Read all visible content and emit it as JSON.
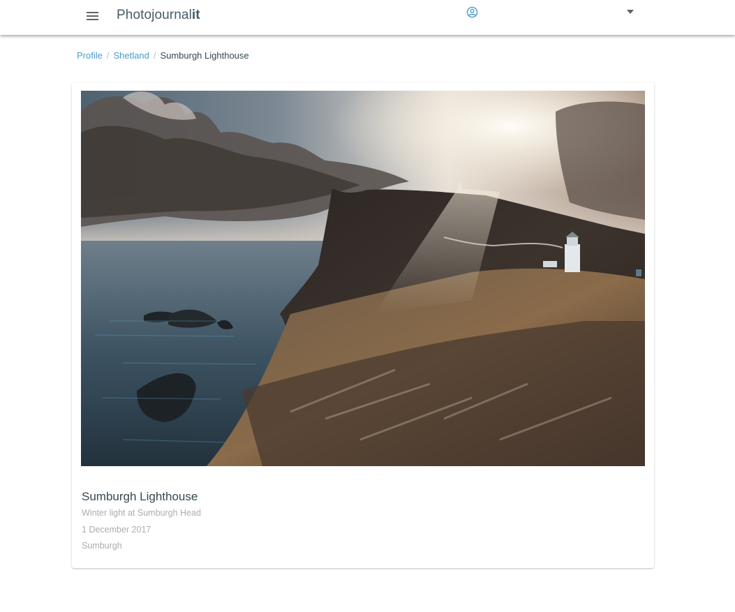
{
  "app": {
    "brand_prefix": "Photojournal",
    "brand_suffix": "it"
  },
  "icons": {
    "menu": "hamburger-menu-icon",
    "account": "account-circle-icon",
    "dropdown": "caret-down-icon"
  },
  "colors": {
    "brand_text": "#455a64",
    "link": "#4a9cc7",
    "account_icon": "#4a9cc7"
  },
  "breadcrumb": {
    "items": [
      "Profile",
      "Shetland"
    ],
    "separator": "/",
    "current": "Sumburgh Lighthouse"
  },
  "photo": {
    "title": "Sumburgh Lighthouse",
    "caption": "Winter light at Sumburgh Head",
    "date": "1 December 2017",
    "location": "Sumburgh"
  }
}
